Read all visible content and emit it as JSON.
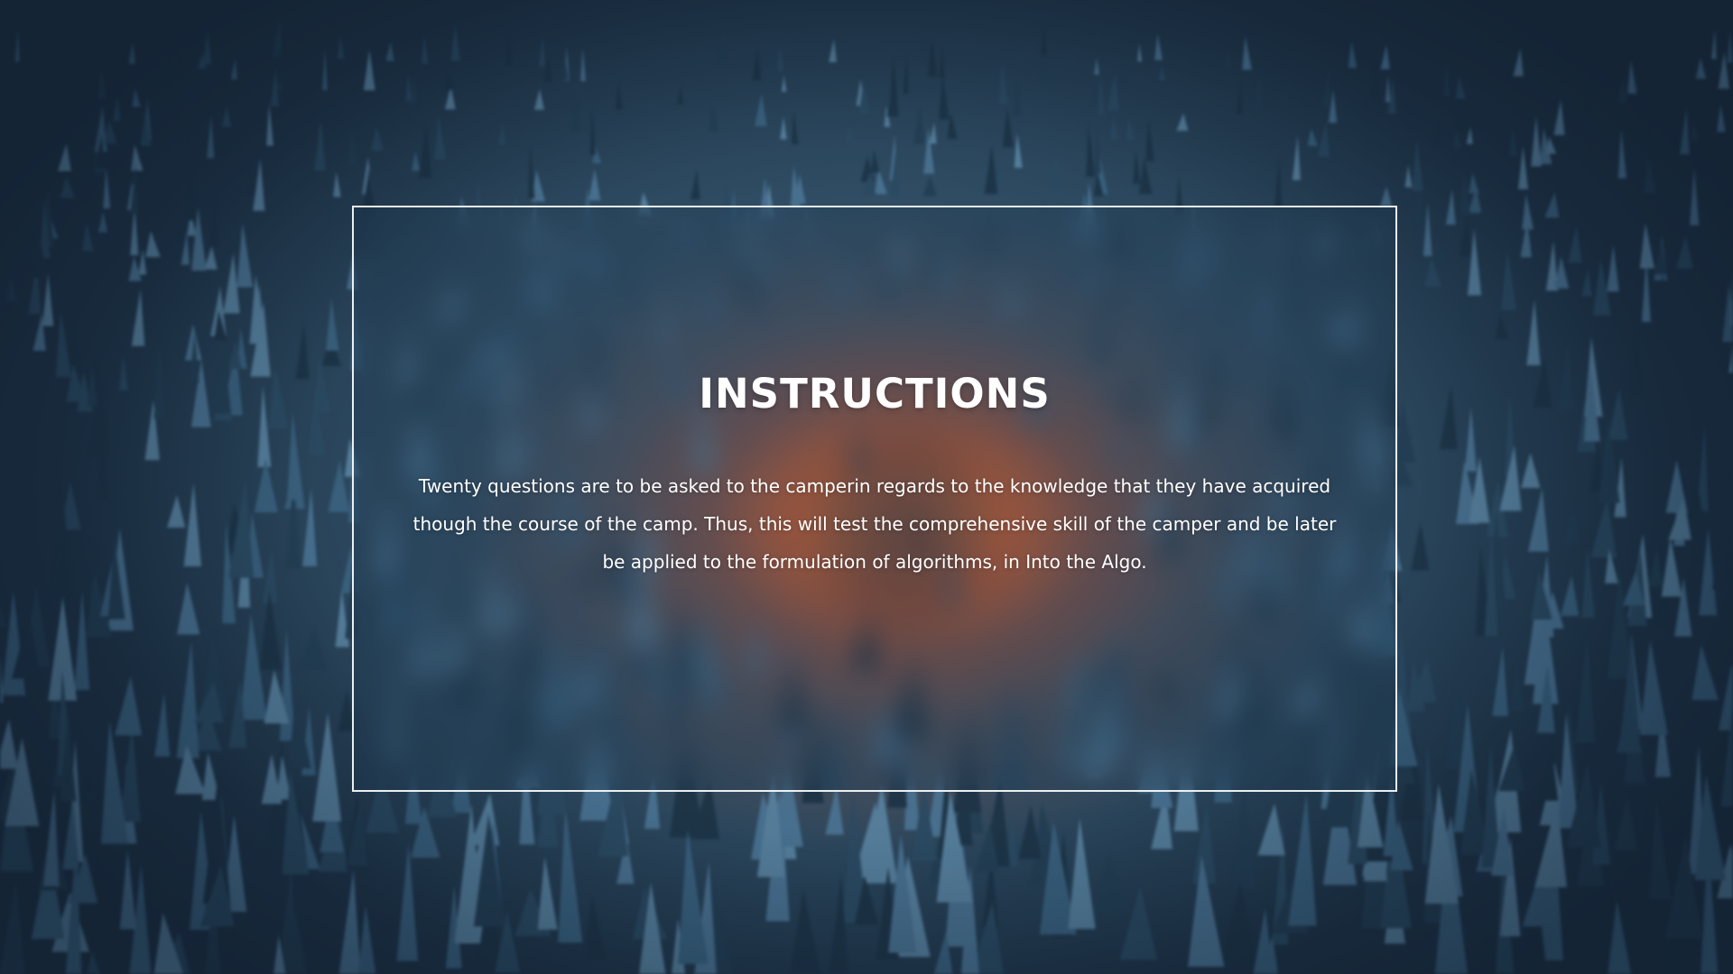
{
  "panel": {
    "title": "INSTRUCTIONS",
    "body": "Twenty questions are to be asked to the camperin regards to the knowledge that they have acquired though the course of the camp. Thus, this will test the comprehensive skill of the camper and be later be applied to the formulation of algorithms, in Into the Algo."
  },
  "colors": {
    "background_blue": "#2f4c63",
    "fire_orange": "#f07030",
    "panel_border": "#ffffff",
    "text": "#ffffff"
  }
}
